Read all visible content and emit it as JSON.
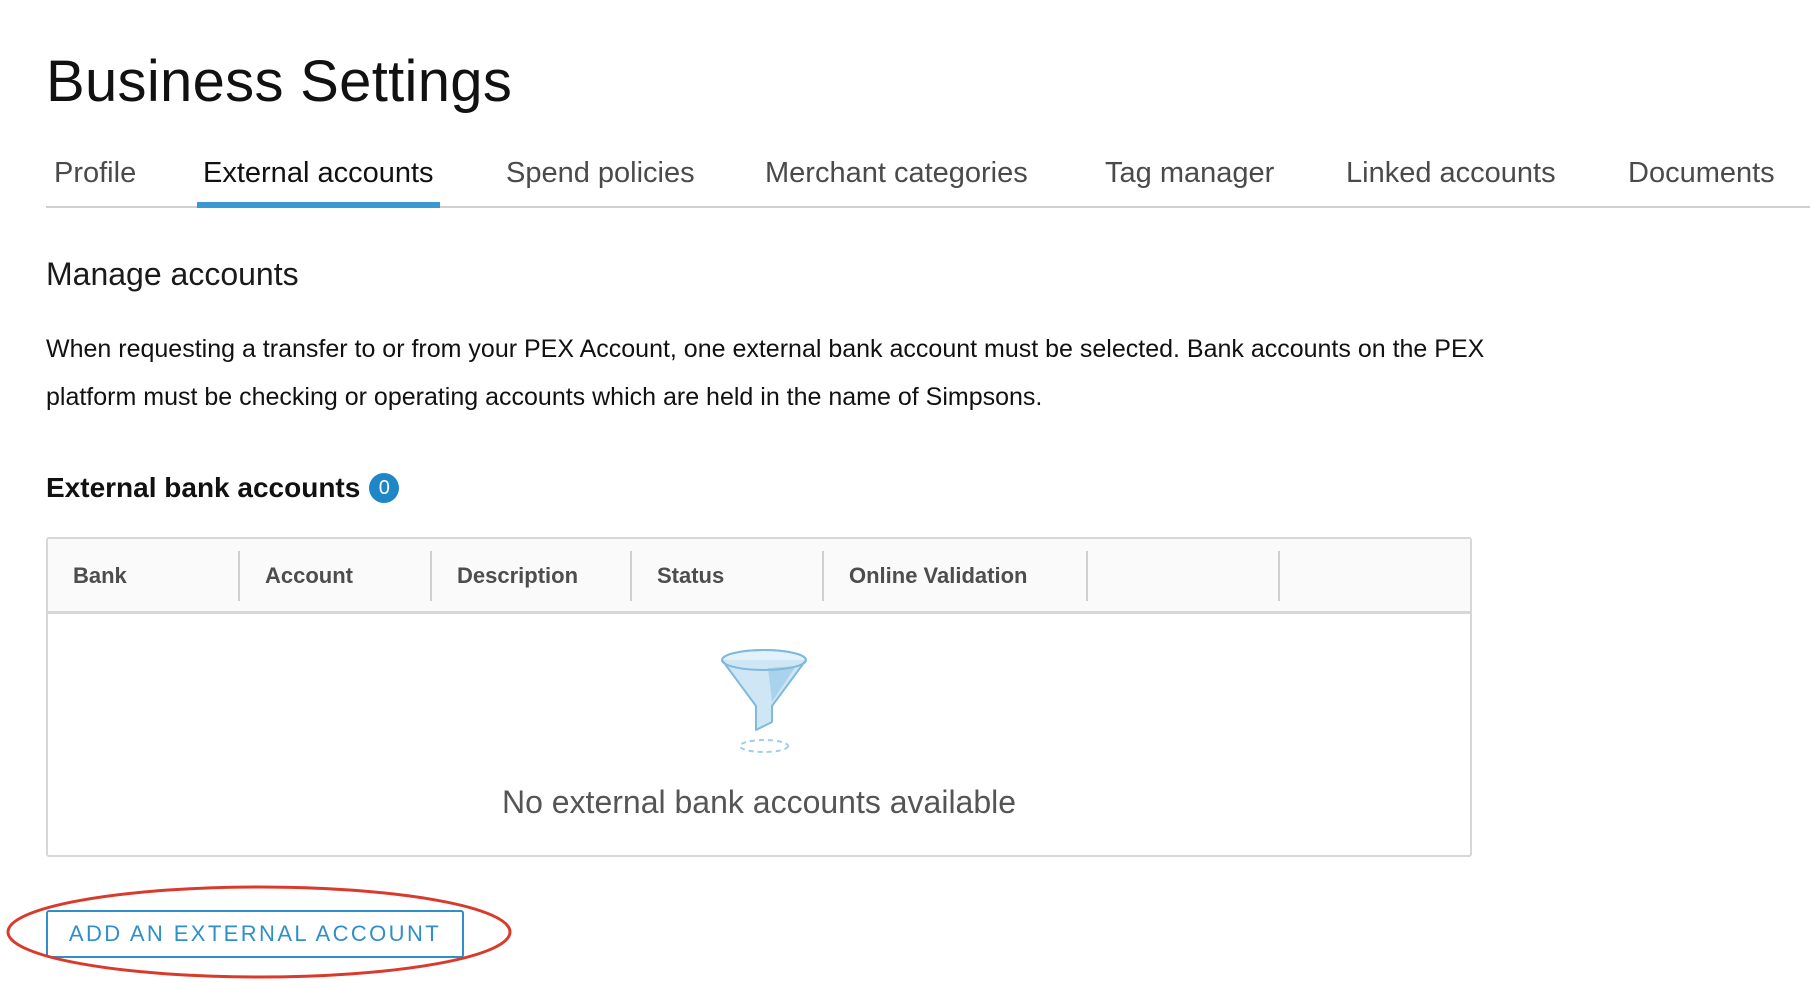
{
  "page": {
    "title": "Business Settings"
  },
  "tabs": [
    {
      "label": "Profile",
      "active": false
    },
    {
      "label": "External accounts",
      "active": true
    },
    {
      "label": "Spend policies",
      "active": false
    },
    {
      "label": "Merchant categories",
      "active": false
    },
    {
      "label": "Tag manager",
      "active": false
    },
    {
      "label": "Linked accounts",
      "active": false
    },
    {
      "label": "Documents",
      "active": false
    }
  ],
  "manage": {
    "title": "Manage accounts",
    "description": "When requesting a transfer to or from your PEX Account, one external bank account must be selected. Bank accounts on the PEX platform must be checking or operating accounts which are held in the name of Simpsons."
  },
  "accounts": {
    "heading": "External bank accounts",
    "count": "0",
    "columns": [
      "Bank",
      "Account",
      "Description",
      "Status",
      "Online Validation",
      "",
      ""
    ],
    "empty_icon": "funnel-icon",
    "empty_message": "No external bank accounts available"
  },
  "actions": {
    "add_label": "ADD AN EXTERNAL ACCOUNT"
  },
  "colors": {
    "accent": "#3a98d2",
    "badge": "#1f87c7",
    "button": "#2f8fca",
    "annotation": "#d93a2b"
  }
}
